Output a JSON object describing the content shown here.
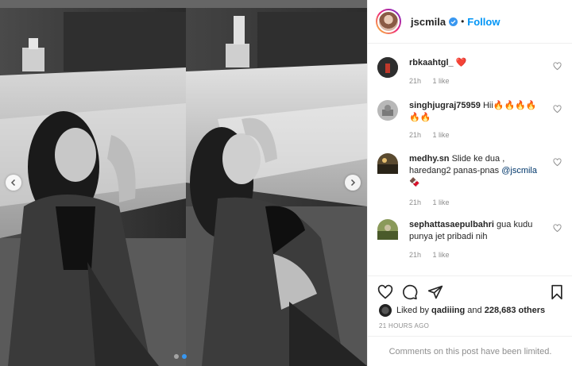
{
  "header": {
    "username": "jscmila",
    "separator": "•",
    "follow_label": "Follow"
  },
  "comments": [
    {
      "user": "rbkaahtgl_",
      "text": "❤️",
      "time": "21h",
      "likes": "1 like",
      "avatar_color": "#3a3a3a"
    },
    {
      "user": "singhjugraj75959",
      "text": "Hii🔥🔥🔥🔥🔥🔥",
      "time": "21h",
      "likes": "1 like",
      "avatar_color": "#9a9a9a"
    },
    {
      "user": "medhy.sn",
      "text_pre": "Slide ke dua , haredang2 panas-pnas",
      "mention": "@jscmila",
      "text_post": "🍫",
      "time": "21h",
      "likes": "1 like",
      "avatar_color": "#6b5a3a"
    },
    {
      "user": "sephattasaepulbahri",
      "text": "gua kudu punya jet pribadi nih",
      "time": "21h",
      "likes": "1 like",
      "avatar_color": "#6f7a4a"
    }
  ],
  "likes": {
    "prefix": "Liked by",
    "user": "qadiiing",
    "middle": "and",
    "count": "228,683 others"
  },
  "timestamp": "21 HOURS AGO",
  "comments_limited": "Comments on this post have been limited.",
  "carousel": {
    "total": 2,
    "active": 1
  },
  "icons": [
    "chevron-left-icon",
    "chevron-right-icon",
    "verified-icon",
    "heart-icon",
    "comment-icon",
    "share-icon",
    "bookmark-icon"
  ],
  "colors": {
    "accent": "#0095f6",
    "muted": "#8e8e8e",
    "heart": "#ed4956"
  }
}
